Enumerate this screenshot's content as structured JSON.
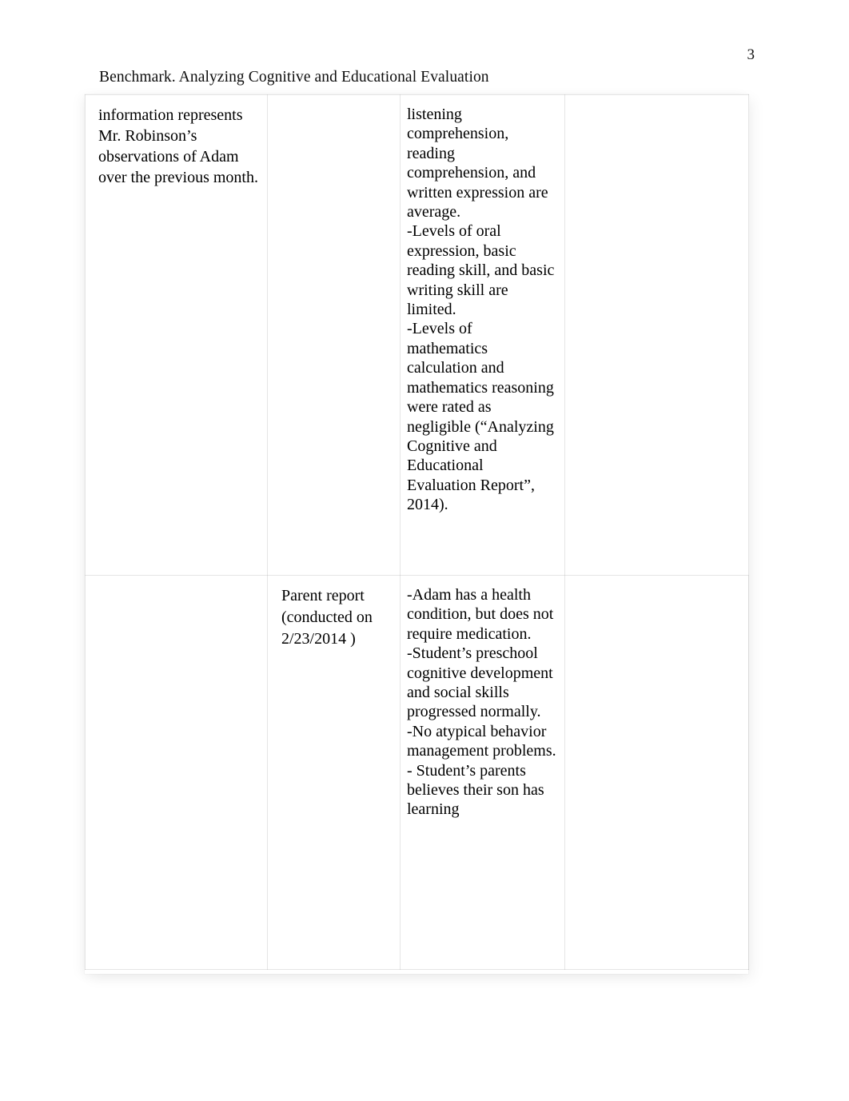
{
  "header": {
    "running_title": "Benchmark. Analyzing Cognitive and Educational Evaluation",
    "page_number": "3"
  },
  "table": {
    "rows": [
      {
        "col1": "information represents Mr. Robinson’s observations of Adam over the previous month.",
        "col2": "",
        "col3": "listening comprehension, reading comprehension, and written expression are average.\n-Levels of oral expression, basic reading skill, and basic writing skill are limited.\n-Levels of mathematics calculation and mathematics reasoning were rated as negligible (“Analyzing Cognitive and Educational Evaluation Report”, 2014).",
        "col4": ""
      },
      {
        "col1": "",
        "col2": "Parent report (conducted on 2/23/2014 )",
        "col3": "-Adam has a health condition, but does not require medication.\n-Student’s preschool cognitive development and social skills progressed normally.\n -No atypical behavior management problems.\n- Student’s parents believes their son has learning",
        "col4": ""
      }
    ]
  },
  "colors": {
    "page_background": "#ffffff",
    "text": "#000000",
    "gridline": "#aaaaaa"
  }
}
